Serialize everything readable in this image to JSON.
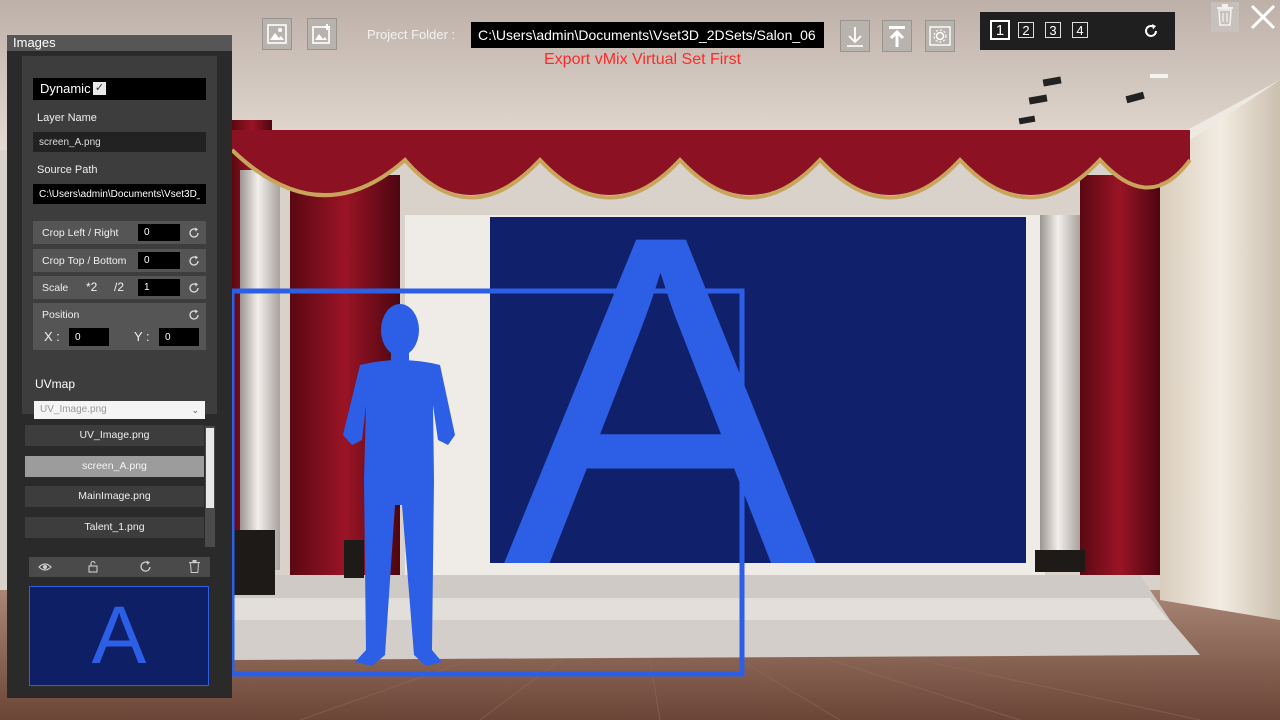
{
  "toolbar": {
    "project_folder_label": "Project Folder :",
    "project_folder_value": "C:\\Users\\admin\\Documents\\Vset3D_2DSets/Salon_06",
    "export_warning": "Export vMix Virtual Set First",
    "icons": [
      "image-icon",
      "add-image-icon",
      "download-icon",
      "upload-icon",
      "settings-icon"
    ]
  },
  "cameras": {
    "items": [
      "1",
      "2",
      "3",
      "4"
    ],
    "active": "1"
  },
  "panel": {
    "title": "Images",
    "dynamic_label": "Dynamic",
    "dynamic_checked": "✓",
    "layer_name_label": "Layer Name",
    "layer_name_value": "screen_A.png",
    "source_path_label": "Source Path",
    "source_path_value": "C:\\Users\\admin\\Documents\\Vset3D_2D",
    "crop_lr_label": "Crop Left / Right",
    "crop_lr_value": "0",
    "crop_tb_label": "Crop Top / Bottom",
    "crop_tb_value": "0",
    "scale_label": "Scale",
    "scale_x2": "*2",
    "scale_div2": "/2",
    "scale_value": "1",
    "position_label": "Position",
    "x_label": "X :",
    "x_value": "0",
    "y_label": "Y :",
    "y_value": "0",
    "uvmap_label": "UVmap",
    "uvmap_value": "UV_Image.png",
    "layers": [
      "UV_Image.png",
      "screen_A.png",
      "MainImage.png",
      "Talent_1.png"
    ],
    "selected_layer": "screen_A.png",
    "preview_letter": "A"
  },
  "scene": {
    "screen_letter": "A"
  },
  "colors": {
    "accent_blue": "#2c5fe6",
    "screen_bg": "#10206a",
    "warning": "#ff2a2a",
    "curtain": "#7e0d1c"
  }
}
